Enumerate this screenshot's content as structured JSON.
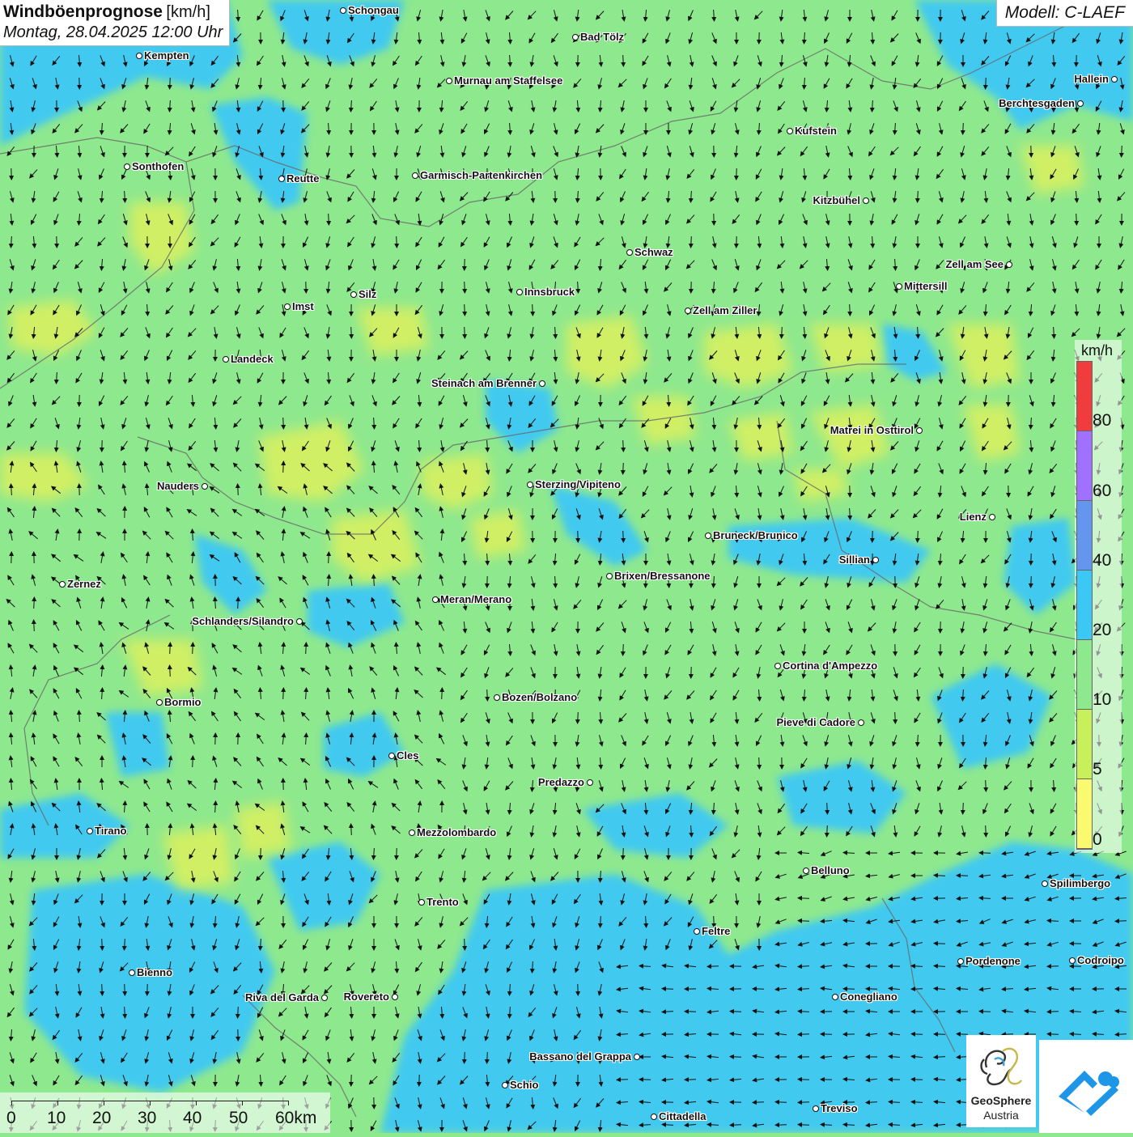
{
  "title": {
    "main": "Windböenprognose",
    "unit": "[km/h]",
    "date": "Montag, 28.04.2025 12:00 Uhr"
  },
  "model": "Modell: C-LAEF",
  "legend": {
    "unit": "km/h",
    "ticks": [
      "80",
      "60",
      "40",
      "20",
      "10",
      "5",
      "0"
    ],
    "colors": [
      "#f03c3c",
      "#a070ff",
      "#6496f0",
      "#3cc8f5",
      "#8ee88e",
      "#c8f05a",
      "#fafa6e"
    ]
  },
  "scale": {
    "labels": [
      "0",
      "10",
      "20",
      "30",
      "40",
      "50",
      "60km"
    ]
  },
  "logo": {
    "name_line1": "GeoSphere",
    "name_line2": "Austria"
  },
  "cities": [
    {
      "name": "Schongau"
    },
    {
      "name": "Bad Tölz"
    },
    {
      "name": "Kempten"
    },
    {
      "name": "Murnau am Staffelsee"
    },
    {
      "name": "Hallein"
    },
    {
      "name": "Berchtesgaden"
    },
    {
      "name": "Kufstein"
    },
    {
      "name": "Sonthofen"
    },
    {
      "name": "Reutte"
    },
    {
      "name": "Garmisch-Partenkirchen"
    },
    {
      "name": "Kitzbühel"
    },
    {
      "name": "Schwaz"
    },
    {
      "name": "Zell am See"
    },
    {
      "name": "Silz"
    },
    {
      "name": "Innsbruck"
    },
    {
      "name": "Mittersill"
    },
    {
      "name": "Imst"
    },
    {
      "name": "Zell am Ziller"
    },
    {
      "name": "Landeck"
    },
    {
      "name": "Steinach am Brenner"
    },
    {
      "name": "Matrei in Osttirol"
    },
    {
      "name": "Nauders"
    },
    {
      "name": "Sterzing/Vipiteno"
    },
    {
      "name": "Lienz"
    },
    {
      "name": "Bruneck/Brunico"
    },
    {
      "name": "Sillian"
    },
    {
      "name": "Brixen/Bressanone"
    },
    {
      "name": "Zernez"
    },
    {
      "name": "Meran/Merano"
    },
    {
      "name": "Schlanders/Silandro"
    },
    {
      "name": "Cortina d'Ampezzo"
    },
    {
      "name": "Bozen/Bolzano"
    },
    {
      "name": "Bormio"
    },
    {
      "name": "Pieve di Cadore"
    },
    {
      "name": "Cles"
    },
    {
      "name": "Predazzo"
    },
    {
      "name": "Tirano"
    },
    {
      "name": "Mezzolombardo"
    },
    {
      "name": "Belluno"
    },
    {
      "name": "Spilimbergo"
    },
    {
      "name": "Trento"
    },
    {
      "name": "Feltre"
    },
    {
      "name": "Pordenone"
    },
    {
      "name": "Codroipo"
    },
    {
      "name": "Bienno"
    },
    {
      "name": "Riva del Garda"
    },
    {
      "name": "Rovereto"
    },
    {
      "name": "Conegliano"
    },
    {
      "name": "Bassano del Grappa"
    },
    {
      "name": "Schio"
    },
    {
      "name": "Treviso"
    },
    {
      "name": "Cittadella"
    }
  ]
}
